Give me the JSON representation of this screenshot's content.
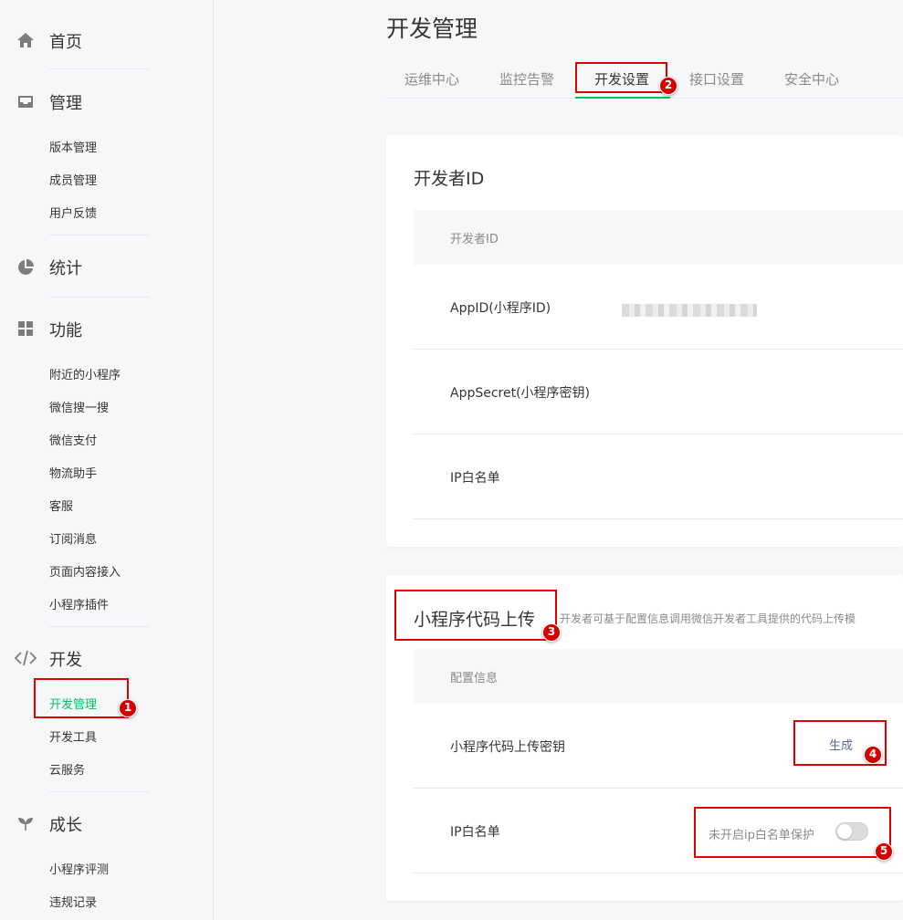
{
  "sidebar": {
    "home": {
      "label": "首页",
      "icon": "home-icon"
    },
    "manage": {
      "label": "管理",
      "icon": "inbox-icon",
      "items": [
        "版本管理",
        "成员管理",
        "用户反馈"
      ]
    },
    "stats": {
      "label": "统计",
      "icon": "pie-chart-icon"
    },
    "features": {
      "label": "功能",
      "icon": "grid-icon",
      "items": [
        "附近的小程序",
        "微信搜一搜",
        "微信支付",
        "物流助手",
        "客服",
        "订阅消息",
        "页面内容接入",
        "小程序插件"
      ]
    },
    "dev": {
      "label": "开发",
      "icon": "code-icon",
      "items": [
        "开发管理",
        "开发工具",
        "云服务"
      ],
      "active_index": 0
    },
    "growth": {
      "label": "成长",
      "icon": "sprout-icon",
      "items": [
        "小程序评测",
        "违规记录"
      ]
    }
  },
  "main": {
    "title": "开发管理",
    "tabs": [
      "运维中心",
      "监控告警",
      "开发设置",
      "接口设置",
      "安全中心"
    ],
    "active_tab": "开发设置",
    "developer_id_card": {
      "title": "开发者ID",
      "header": "开发者ID",
      "rows": [
        "AppID(小程序ID)",
        "AppSecret(小程序密钥)",
        "IP白名单"
      ]
    },
    "upload_card": {
      "title": "小程序代码上传",
      "description": "开发者可基于配置信息调用微信开发者工具提供的代码上传模",
      "header": "配置信息",
      "rows": [
        "小程序代码上传密钥",
        "IP白名单"
      ],
      "generate_link": "生成",
      "toggle_label": "未开启ip白名单保护"
    }
  },
  "annotations": [
    "1",
    "2",
    "3",
    "4",
    "5"
  ],
  "colors": {
    "accent": "#07c160",
    "annotation": "#e00000",
    "link": "#576b95"
  }
}
